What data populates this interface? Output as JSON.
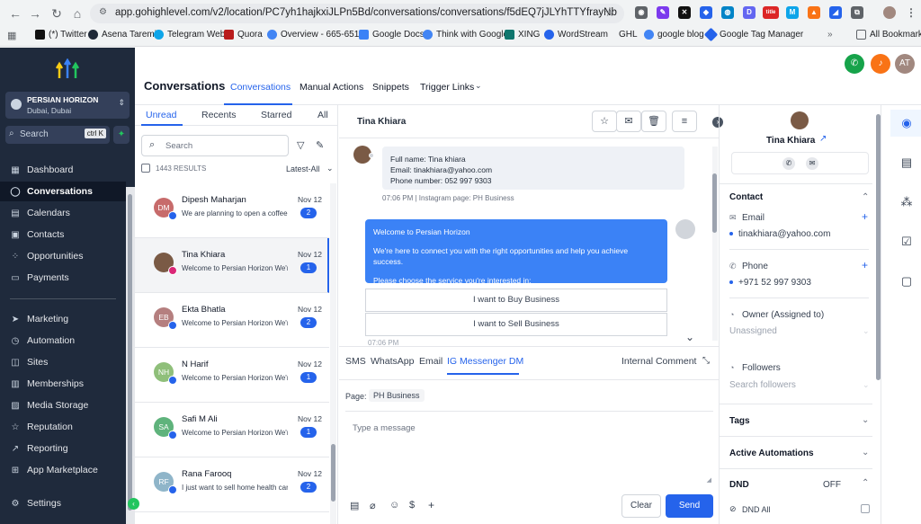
{
  "browser": {
    "url": "app.gohighlevel.com/v2/location/PC7yh1hajkxiJLPn5Bd/conversations/conversations/f5dEQ7jJLYhTTYfrayNb",
    "bookmarks": [
      "(*) Twitter",
      "Asena Taremi",
      "Telegram Web",
      "Quora",
      "Overview - 665-651...",
      "Google Docs",
      "Think with Google",
      "XING",
      "WordStream",
      "GHL",
      "google blog",
      "Google Tag Manager"
    ],
    "all_bookmarks": "All Bookmarks",
    "ext_title": "title"
  },
  "sidebar": {
    "location_name": "PERSIAN HORIZON",
    "location_sub": "Dubai, Dubai",
    "search_placeholder": "Search",
    "search_shortcut": "ctrl K",
    "items": [
      "Dashboard",
      "Conversations",
      "Calendars",
      "Contacts",
      "Opportunities",
      "Payments",
      "Marketing",
      "Automation",
      "Sites",
      "Memberships",
      "Media Storage",
      "Reputation",
      "Reporting",
      "App Marketplace",
      "Settings"
    ]
  },
  "header": {
    "title": "Conversations",
    "tabs": [
      "Conversations",
      "Manual Actions",
      "Snippets",
      "Trigger Links"
    ],
    "avatar_initials": "AT"
  },
  "list": {
    "tabs": [
      "Unread",
      "Recents",
      "Starred",
      "All"
    ],
    "search_placeholder": "Search",
    "results": "1443 RESULTS",
    "sort": "Latest-All",
    "conversations": [
      {
        "initials": "DM",
        "name": "Dipesh Maharjan",
        "preview": "We are planning to open a coffee",
        "date": "Nov 12",
        "count": "2",
        "color": "#c76b6b",
        "channel": "#2563eb"
      },
      {
        "initials": "",
        "name": "Tina Khiara",
        "preview": "Welcome to Persian Horizon We're",
        "date": "Nov 12",
        "count": "1",
        "color": "#7a5a45",
        "channel": "#db2777"
      },
      {
        "initials": "EB",
        "name": "Ekta Bhatla",
        "preview": "Welcome to Persian Horizon We're",
        "date": "Nov 12",
        "count": "2",
        "color": "#b57f7f",
        "channel": "#2563eb"
      },
      {
        "initials": "NH",
        "name": "N Harif",
        "preview": "Welcome to Persian Horizon We're",
        "date": "Nov 12",
        "count": "1",
        "color": "#8fbf7a",
        "channel": "#2563eb"
      },
      {
        "initials": "SA",
        "name": "Safi M Ali",
        "preview": "Welcome to Persian Horizon We're",
        "date": "Nov 12",
        "count": "1",
        "color": "#5fb37c",
        "channel": "#2563eb"
      },
      {
        "initials": "RF",
        "name": "Rana Farooq",
        "preview": "I just want to sell home health car",
        "date": "Nov 12",
        "count": "2",
        "color": "#8fb5c9",
        "channel": "#2563eb"
      }
    ]
  },
  "chat": {
    "contact_name": "Tina Khiara",
    "incoming": {
      "lines": [
        "Full name: Tina khiara",
        "Email: tinakhiara@yahoo.com",
        "Phone number: 052 997 9303"
      ],
      "meta": "07:06 PM | Instagram page: PH Business"
    },
    "outgoing": {
      "lines": [
        "Welcome to Persian Horizon",
        "We're here to connect you with the right opportunities and help you achieve success.",
        "Please choose the service you're interested in:"
      ]
    },
    "choices": [
      "I want to Buy Business",
      "I want to Sell Business"
    ],
    "meta_partial": "07:06 PM",
    "composer": {
      "tabs": [
        "SMS",
        "WhatsApp",
        "Email",
        "IG Messenger DM"
      ],
      "internal_comment": "Internal Comment",
      "page_label": "Page:",
      "page_value": "PH Business",
      "placeholder": "Type a message",
      "clear": "Clear",
      "send": "Send"
    }
  },
  "contact": {
    "name": "Tina Khiara",
    "section_contact": "Contact",
    "email_label": "Email",
    "email": "tinakhiara@yahoo.com",
    "phone_label": "Phone",
    "phone": "+971 52 997 9303",
    "owner_label": "Owner (Assigned to)",
    "owner_value": "Unassigned",
    "followers_label": "Followers",
    "followers_placeholder": "Search followers",
    "tags": "Tags",
    "automations": "Active Automations",
    "dnd": "DND",
    "dnd_state": "OFF",
    "dnd_all": "DND All"
  },
  "colors": {
    "accent": "#2563eb",
    "sidebar_bg": "#1f2a3c",
    "outgoing_bubble": "#3b82f6",
    "call_green": "#16a34a",
    "bell_orange": "#f97316",
    "avatar_brown": "#a1887f"
  }
}
